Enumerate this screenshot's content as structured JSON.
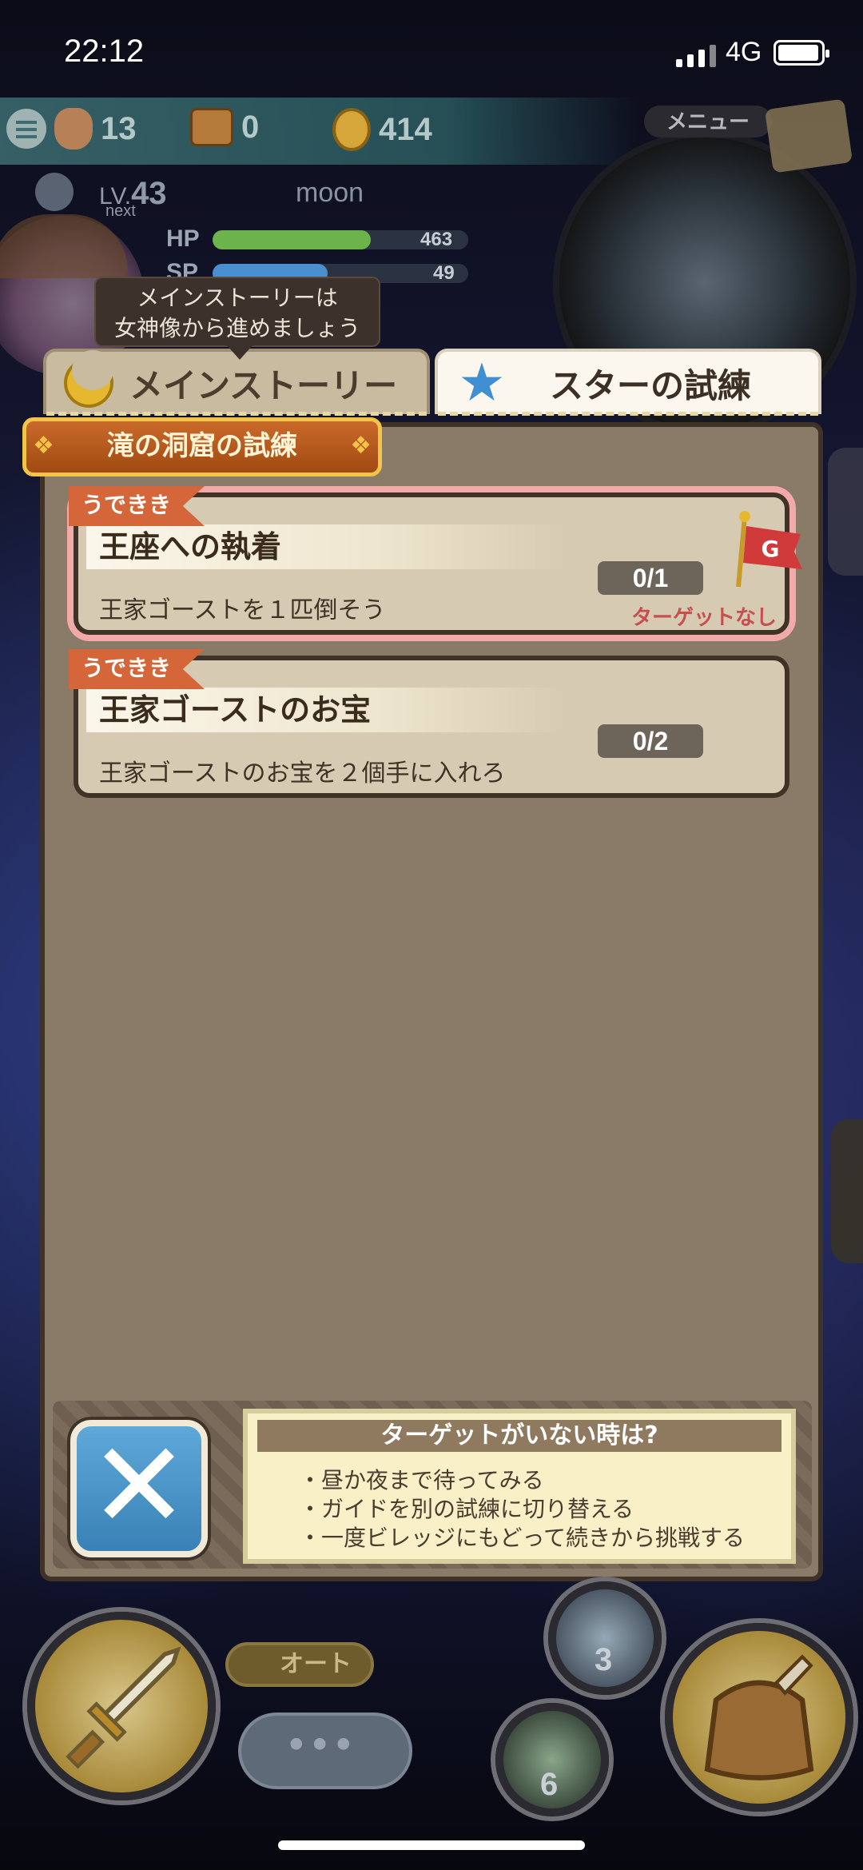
{
  "status_bar": {
    "time": "22:12",
    "network": "4G"
  },
  "resources": {
    "bags": "13",
    "chests": "0",
    "coins": "414"
  },
  "player": {
    "level_prefix": "LV.",
    "level": "43",
    "next_label": "next",
    "name": "moon",
    "hp_label": "HP",
    "hp_value": "463",
    "hp_fraction": 0.62,
    "sp_label": "SP",
    "sp_value": "49",
    "sp_fraction": 0.45
  },
  "minimap": {
    "menu_label": "メニュー"
  },
  "tooltip": {
    "line1": "メインストーリーは",
    "line2": "女神像から進めましょう"
  },
  "tabs": {
    "main_story": "メインストーリー",
    "star_trial": "スターの試練"
  },
  "section_banner": "滝の洞窟の試練",
  "quests": [
    {
      "badge": "うできき",
      "title": "王座への執着",
      "description": "王家ゴーストを１匹倒そう",
      "progress": "0/1",
      "status": "ターゲットなし",
      "selected": true
    },
    {
      "badge": "うできき",
      "title": "王家ゴーストのお宝",
      "description": "王家ゴーストのお宝を２個手に入れろ",
      "progress": "0/2",
      "status": "",
      "selected": false
    }
  ],
  "hint": {
    "title": "ターゲットがいない時は?",
    "lines": [
      "・昼か夜まで待ってみる",
      "・ガイドを別の試練に切り替える",
      "・一度ビレッジにもどって続きから挑戦する"
    ]
  },
  "hud": {
    "auto_label": "オート",
    "potion_count": "3",
    "meat_count": "6"
  },
  "colors": {
    "panel": "#8a7a68",
    "card": "#d6cbb2",
    "accent_orange": "#d5663a",
    "close_blue": "#4a92c8"
  }
}
